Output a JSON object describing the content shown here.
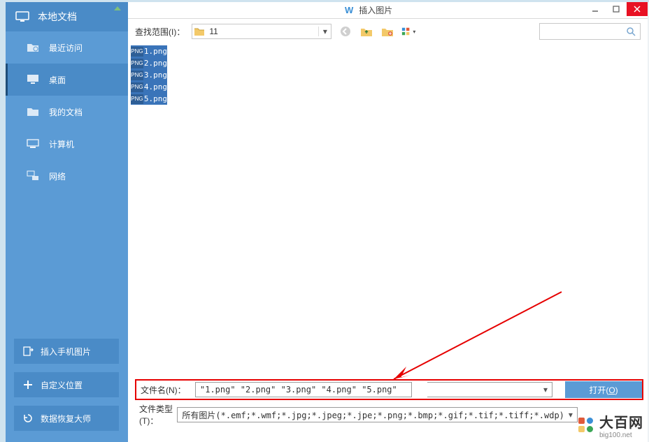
{
  "window": {
    "title": "插入图片",
    "min_tip": "最小化",
    "max_tip": "最大化",
    "close_tip": "关闭"
  },
  "sidebar": {
    "header": "本地文档",
    "items": [
      {
        "label": "最近访问"
      },
      {
        "label": "桌面"
      },
      {
        "label": "我的文档"
      },
      {
        "label": "计算机"
      },
      {
        "label": "网络"
      }
    ],
    "footer": [
      {
        "label": "插入手机图片"
      },
      {
        "label": "自定义位置"
      },
      {
        "label": "数据恢复大师"
      }
    ]
  },
  "toolbar": {
    "range_label": "查找范围(I)：",
    "dir_value": "11",
    "back_tip": "后退",
    "up_tip": "向上",
    "newfolder_tip": "新建文件夹",
    "view_tip": "视图"
  },
  "files": [
    {
      "name": "1.png"
    },
    {
      "name": "2.png"
    },
    {
      "name": "3.png"
    },
    {
      "name": "4.png"
    },
    {
      "name": "5.png"
    }
  ],
  "form": {
    "filename_label": "文件名(N)：",
    "filename_value": "\"1.png\" \"2.png\" \"3.png\" \"4.png\" \"5.png\"",
    "filetype_label": "文件类型(T)：",
    "filetype_value": "所有图片(*.emf;*.wmf;*.jpg;*.jpeg;*.jpe;*.png;*.bmp;*.gif;*.tif;*.tiff;*.wdp)",
    "open_label": "打开(O)"
  },
  "watermark": {
    "brand": "大百网",
    "url": "big100.net"
  },
  "thumb_badge": "PNG"
}
